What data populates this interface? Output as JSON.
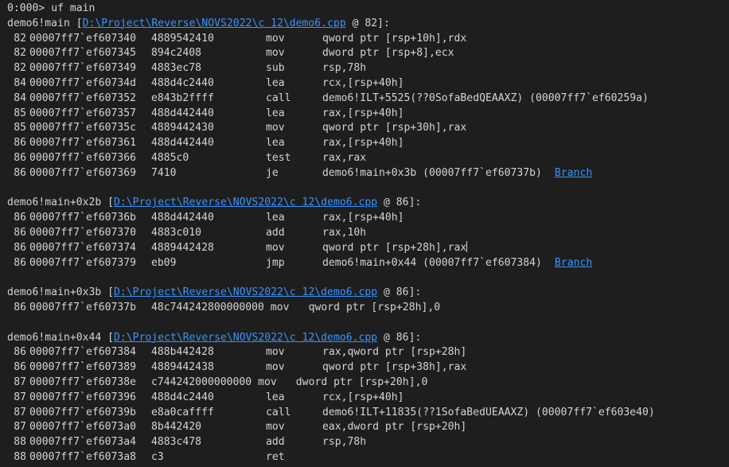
{
  "prompt": "0:000>",
  "command": "uf main",
  "blocks": [
    {
      "label": "demo6!main",
      "path": "D:\\Project\\Reverse\\NOVS2022\\c 12\\demo6.cpp",
      "line_ref": "82",
      "rows": [
        {
          "line": "82",
          "addr": "00007ff7`ef607340",
          "bytes": "4889542410",
          "mnemonic": "mov",
          "operands": "qword ptr [rsp+10h],rdx"
        },
        {
          "line": "82",
          "addr": "00007ff7`ef607345",
          "bytes": "894c2408",
          "mnemonic": "mov",
          "operands": "dword ptr [rsp+8],ecx"
        },
        {
          "line": "82",
          "addr": "00007ff7`ef607349",
          "bytes": "4883ec78",
          "mnemonic": "sub",
          "operands": "rsp,78h"
        },
        {
          "line": "84",
          "addr": "00007ff7`ef60734d",
          "bytes": "488d4c2440",
          "mnemonic": "lea",
          "operands": "rcx,[rsp+40h]"
        },
        {
          "line": "84",
          "addr": "00007ff7`ef607352",
          "bytes": "e843b2ffff",
          "mnemonic": "call",
          "operands": "demo6!ILT+5525(??0SofaBedQEAAXZ) (00007ff7`ef60259a)"
        },
        {
          "line": "85",
          "addr": "00007ff7`ef607357",
          "bytes": "488d442440",
          "mnemonic": "lea",
          "operands": "rax,[rsp+40h]"
        },
        {
          "line": "85",
          "addr": "00007ff7`ef60735c",
          "bytes": "4889442430",
          "mnemonic": "mov",
          "operands": "qword ptr [rsp+30h],rax"
        },
        {
          "line": "86",
          "addr": "00007ff7`ef607361",
          "bytes": "488d442440",
          "mnemonic": "lea",
          "operands": "rax,[rsp+40h]"
        },
        {
          "line": "86",
          "addr": "00007ff7`ef607366",
          "bytes": "4885c0",
          "mnemonic": "test",
          "operands": "rax,rax"
        },
        {
          "line": "86",
          "addr": "00007ff7`ef607369",
          "bytes": "7410",
          "mnemonic": "je",
          "operands": "demo6!main+0x3b (00007ff7`ef60737b)",
          "branch": "Branch"
        }
      ]
    },
    {
      "label": "demo6!main+0x2b",
      "path": "D:\\Project\\Reverse\\NOVS2022\\c 12\\demo6.cpp",
      "line_ref": "86",
      "rows": [
        {
          "line": "86",
          "addr": "00007ff7`ef60736b",
          "bytes": "488d442440",
          "mnemonic": "lea",
          "operands": "rax,[rsp+40h]"
        },
        {
          "line": "86",
          "addr": "00007ff7`ef607370",
          "bytes": "4883c010",
          "mnemonic": "add",
          "operands": "rax,10h"
        },
        {
          "line": "86",
          "addr": "00007ff7`ef607374",
          "bytes": "4889442428",
          "mnemonic": "mov",
          "operands": "qword ptr [rsp+28h],rax",
          "cursor": true
        },
        {
          "line": "86",
          "addr": "00007ff7`ef607379",
          "bytes": "eb09",
          "mnemonic": "jmp",
          "operands": "demo6!main+0x44 (00007ff7`ef607384)",
          "branch": "Branch"
        }
      ]
    },
    {
      "label": "demo6!main+0x3b",
      "path": "D:\\Project\\Reverse\\NOVS2022\\c 12\\demo6.cpp",
      "line_ref": "86",
      "rows": [
        {
          "line": "86",
          "addr": "00007ff7`ef60737b",
          "bytes": "48c744242800000000",
          "mnemonic": "mov",
          "operands": "qword ptr [rsp+28h],0",
          "wide": true
        }
      ]
    },
    {
      "label": "demo6!main+0x44",
      "path": "D:\\Project\\Reverse\\NOVS2022\\c 12\\demo6.cpp",
      "line_ref": "86",
      "rows": [
        {
          "line": "86",
          "addr": "00007ff7`ef607384",
          "bytes": "488b442428",
          "mnemonic": "mov",
          "operands": "rax,qword ptr [rsp+28h]"
        },
        {
          "line": "86",
          "addr": "00007ff7`ef607389",
          "bytes": "4889442438",
          "mnemonic": "mov",
          "operands": "qword ptr [rsp+38h],rax"
        },
        {
          "line": "87",
          "addr": "00007ff7`ef60738e",
          "bytes": "c744242000000000",
          "mnemonic": "mov",
          "operands": "dword ptr [rsp+20h],0",
          "wide": true
        },
        {
          "line": "87",
          "addr": "00007ff7`ef607396",
          "bytes": "488d4c2440",
          "mnemonic": "lea",
          "operands": "rcx,[rsp+40h]"
        },
        {
          "line": "87",
          "addr": "00007ff7`ef60739b",
          "bytes": "e8a0caffff",
          "mnemonic": "call",
          "operands": "demo6!ILT+11835(??1SofaBedUEAAXZ) (00007ff7`ef603e40)"
        },
        {
          "line": "87",
          "addr": "00007ff7`ef6073a0",
          "bytes": "8b442420",
          "mnemonic": "mov",
          "operands": "eax,dword ptr [rsp+20h]"
        },
        {
          "line": "88",
          "addr": "00007ff7`ef6073a4",
          "bytes": "4883c478",
          "mnemonic": "add",
          "operands": "rsp,78h"
        },
        {
          "line": "88",
          "addr": "00007ff7`ef6073a8",
          "bytes": "c3",
          "mnemonic": "ret",
          "operands": ""
        }
      ]
    }
  ]
}
